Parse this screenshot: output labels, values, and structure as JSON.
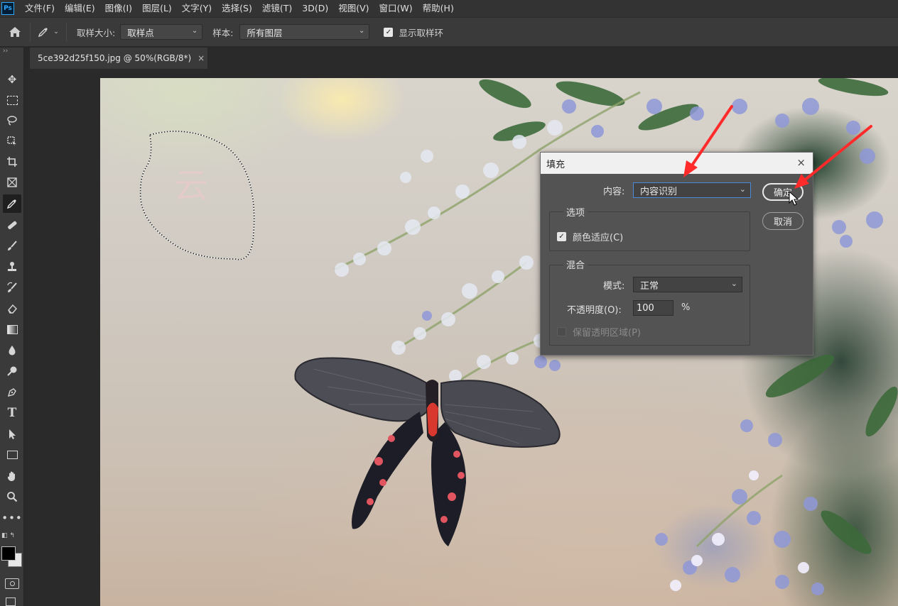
{
  "app": {
    "logo": "Ps"
  },
  "menu": [
    "文件(F)",
    "编辑(E)",
    "图像(I)",
    "图层(L)",
    "文字(Y)",
    "选择(S)",
    "滤镜(T)",
    "3D(D)",
    "视图(V)",
    "窗口(W)",
    "帮助(H)"
  ],
  "options": {
    "sample_size_label": "取样大小:",
    "sample_size_value": "取样点",
    "sample_label": "样本:",
    "sample_value": "所有图层",
    "show_ring_label": "显示取样环",
    "show_ring_checked": true
  },
  "document": {
    "tab_title": "5ce392d25f150.jpg @ 50%(RGB/8*)",
    "close": "×"
  },
  "toolbar": {
    "collapse": "››"
  },
  "canvas": {
    "watermark_text": "云"
  },
  "dialog": {
    "title": "填充",
    "close": "×",
    "content_label": "内容:",
    "content_value": "内容识别",
    "options_group": "选项",
    "color_adapt_label": "颜色适应(C)",
    "color_adapt_checked": true,
    "blend_group": "混合",
    "mode_label": "模式:",
    "mode_value": "正常",
    "opacity_label": "不透明度(O):",
    "opacity_value": "100",
    "opacity_unit": "%",
    "preserve_label": "保留透明区域(P)",
    "preserve_checked": false,
    "ok_label": "确定",
    "cancel_label": "取消"
  },
  "colors": {
    "accent": "#4a8ad8",
    "annotation_arrow": "#ff2a2a"
  }
}
